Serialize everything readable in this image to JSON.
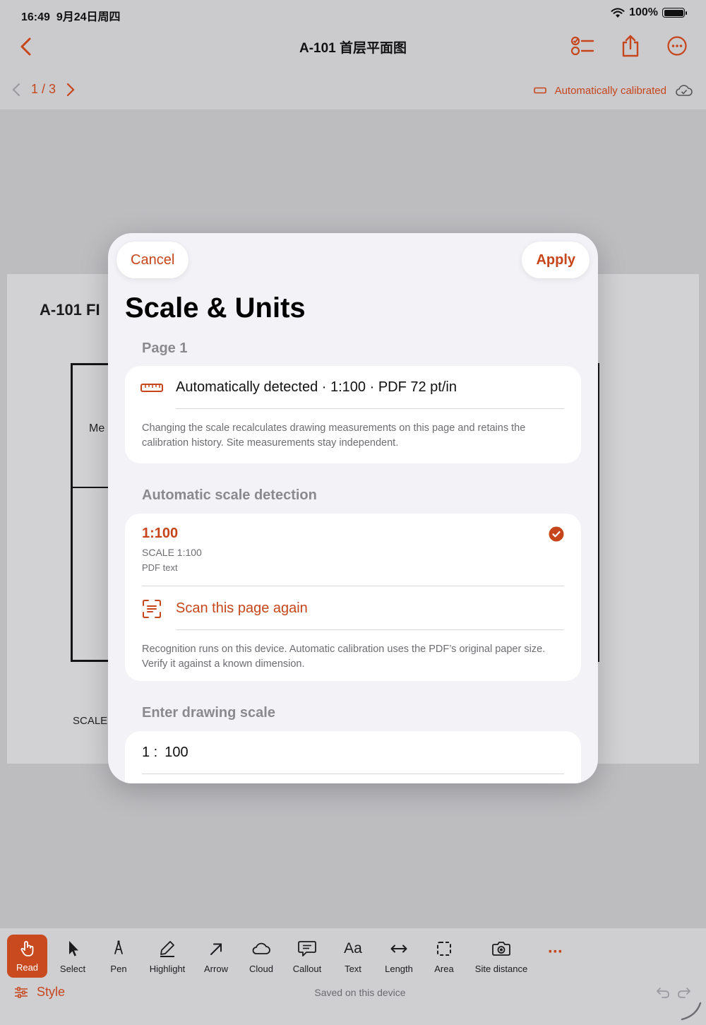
{
  "status_bar": {
    "time": "16:49",
    "date": "9月24日周四",
    "battery": "100%",
    "wifi_icon": "wifi-icon",
    "battery_icon": "battery-icon"
  },
  "nav": {
    "title": "A-101 首层平面图",
    "back_icon": "chevron-left-icon",
    "checklist_icon": "checklist-icon",
    "share_icon": "share-icon",
    "more_icon": "ellipsis-circle-icon"
  },
  "page_nav": {
    "indicator": "1 / 3"
  },
  "calibration": {
    "label": "Automatically calibrated",
    "ruler_icon": "ruler-icon",
    "cloud_icon": "cloud-check-icon"
  },
  "document": {
    "heading": "A-101 FI",
    "room_label": "Me",
    "scale_label": "SCALE"
  },
  "sheet": {
    "cancel_label": "Cancel",
    "apply_label": "Apply",
    "title": "Scale & Units",
    "page_section": {
      "header": "Page 1",
      "detected_text": "Automatically detected · 1:100 · PDF 72 pt/in",
      "footnote": "Changing the scale recalculates drawing measurements on this page and retains the calibration history. Site measurements stay independent."
    },
    "auto_section": {
      "header": "Automatic scale detection",
      "option_title": "1:100",
      "option_subtitle": "SCALE 1:100",
      "option_source": "PDF text",
      "scan_label": "Scan this page again",
      "footnote": "Recognition runs on this device. Automatic calibration uses the PDF’s original paper size. Verify it against a known dimension."
    },
    "manual_section": {
      "header": "Enter drawing scale",
      "prefix": "1 :",
      "value": "100"
    }
  },
  "toolbar": {
    "tools": [
      {
        "label": "Read",
        "icon": "hand-pointer-icon"
      },
      {
        "label": "Select",
        "icon": "cursor-arrow-icon"
      },
      {
        "label": "Pen",
        "icon": "pen-icon"
      },
      {
        "label": "Highlight",
        "icon": "highlighter-icon"
      },
      {
        "label": "Arrow",
        "icon": "arrow-icon"
      },
      {
        "label": "Cloud",
        "icon": "cloud-icon"
      },
      {
        "label": "Callout",
        "icon": "callout-icon"
      },
      {
        "label": "Text",
        "icon": "text-icon"
      },
      {
        "label": "Length",
        "icon": "length-icon"
      },
      {
        "label": "Area",
        "icon": "area-icon"
      },
      {
        "label": "Site distance",
        "icon": "camera-measure-icon"
      }
    ],
    "text_glyph": "Aa",
    "more_glyph": "···",
    "style_label": "Style",
    "saved_label": "Saved on this device",
    "undo_icon": "undo-icon",
    "redo_icon": "redo-icon"
  },
  "colors": {
    "accent": "#c7451b",
    "sheet_bg": "#f2f2f7",
    "read_bg": "#c94a1e"
  }
}
